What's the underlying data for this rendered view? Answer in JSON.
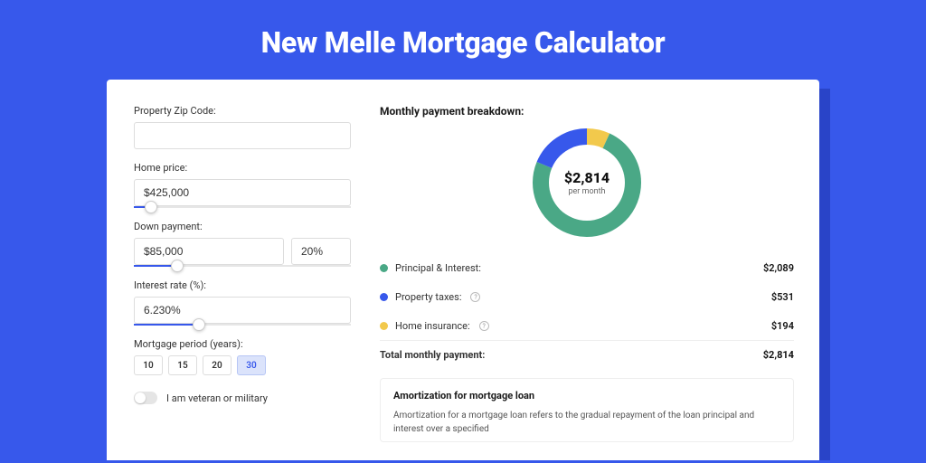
{
  "hero": {
    "title": "New Melle Mortgage Calculator"
  },
  "form": {
    "zip": {
      "label": "Property Zip Code:",
      "value": ""
    },
    "home_price": {
      "label": "Home price:",
      "value": "$425,000",
      "slider_pct": 8
    },
    "down_payment": {
      "label": "Down payment:",
      "value": "$85,000",
      "pct_value": "20%",
      "slider_pct": 20
    },
    "interest_rate": {
      "label": "Interest rate (%):",
      "value": "6.230%",
      "slider_pct": 30
    },
    "period": {
      "label": "Mortgage period (years):",
      "options": [
        "10",
        "15",
        "20",
        "30"
      ],
      "selected": "30"
    },
    "veteran": {
      "label": "I am veteran or military",
      "checked": false
    }
  },
  "breakdown": {
    "title": "Monthly payment breakdown:",
    "center_value": "$2,814",
    "center_sub": "per month",
    "items": [
      {
        "label": "Principal & Interest:",
        "value": "$2,089",
        "color": "#4aa886",
        "has_info": false,
        "raw": 2089
      },
      {
        "label": "Property taxes:",
        "value": "$531",
        "color": "#3758eb",
        "has_info": true,
        "raw": 531
      },
      {
        "label": "Home insurance:",
        "value": "$194",
        "color": "#f2c94c",
        "has_info": true,
        "raw": 194
      }
    ],
    "total": {
      "label": "Total monthly payment:",
      "value": "$2,814"
    }
  },
  "chart_data": {
    "type": "pie",
    "title": "Monthly payment breakdown",
    "series": [
      {
        "name": "Principal & Interest",
        "value": 2089,
        "color": "#4aa886"
      },
      {
        "name": "Property taxes",
        "value": 531,
        "color": "#3758eb"
      },
      {
        "name": "Home insurance",
        "value": 194,
        "color": "#f2c94c"
      }
    ],
    "center_label": "$2,814",
    "center_sublabel": "per month"
  },
  "amortization": {
    "title": "Amortization for mortgage loan",
    "text": "Amortization for a mortgage loan refers to the gradual repayment of the loan principal and interest over a specified"
  }
}
